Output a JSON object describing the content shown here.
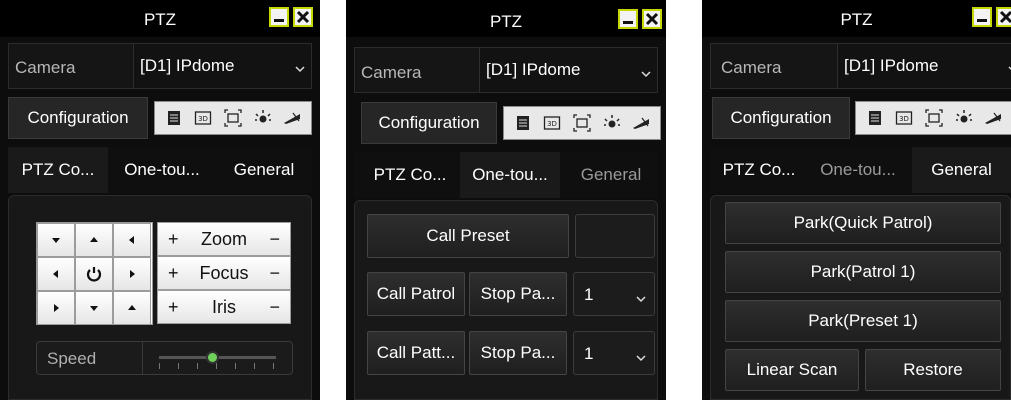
{
  "panels": [
    {
      "title": "PTZ",
      "camera_label": "Camera",
      "camera_value": "[D1] IPdome",
      "configuration_label": "Configuration",
      "tabs": [
        "PTZ Co...",
        "One-tou...",
        "General"
      ],
      "active_tab": 0,
      "controls": {
        "zoom_label": "Zoom",
        "focus_label": "Focus",
        "iris_label": "Iris",
        "plus": "+",
        "minus": "−",
        "speed_label": "Speed"
      }
    },
    {
      "title": "PTZ",
      "camera_label": "Camera",
      "camera_value": "[D1] IPdome",
      "configuration_label": "Configuration",
      "tabs": [
        "PTZ Co...",
        "One-tou...",
        "General"
      ],
      "active_tab": 1,
      "controls": {
        "call_preset": "Call Preset",
        "call_patrol": "Call Patrol",
        "stop_patrol": "Stop Pa...",
        "patrol_value": "1",
        "call_pattern": "Call Patt...",
        "stop_pattern": "Stop Pa...",
        "pattern_value": "1"
      }
    },
    {
      "title": "PTZ",
      "camera_label": "Camera",
      "camera_value": "[D1] IPdome",
      "configuration_label": "Configuration",
      "tabs": [
        "PTZ Co...",
        "One-tou...",
        "General"
      ],
      "active_tab": 2,
      "controls": {
        "park_quick_patrol": "Park(Quick Patrol)",
        "park_patrol_1": "Park(Patrol 1)",
        "park_preset_1": "Park(Preset 1)",
        "linear_scan": "Linear Scan",
        "restore": "Restore"
      }
    }
  ],
  "toolbar_icons": [
    "list-icon",
    "3d-icon",
    "fullscreen-icon",
    "light-icon",
    "wiper-icon"
  ],
  "colors": {
    "accent": "#c5d900",
    "speed_thumb": "#6ed15a"
  }
}
